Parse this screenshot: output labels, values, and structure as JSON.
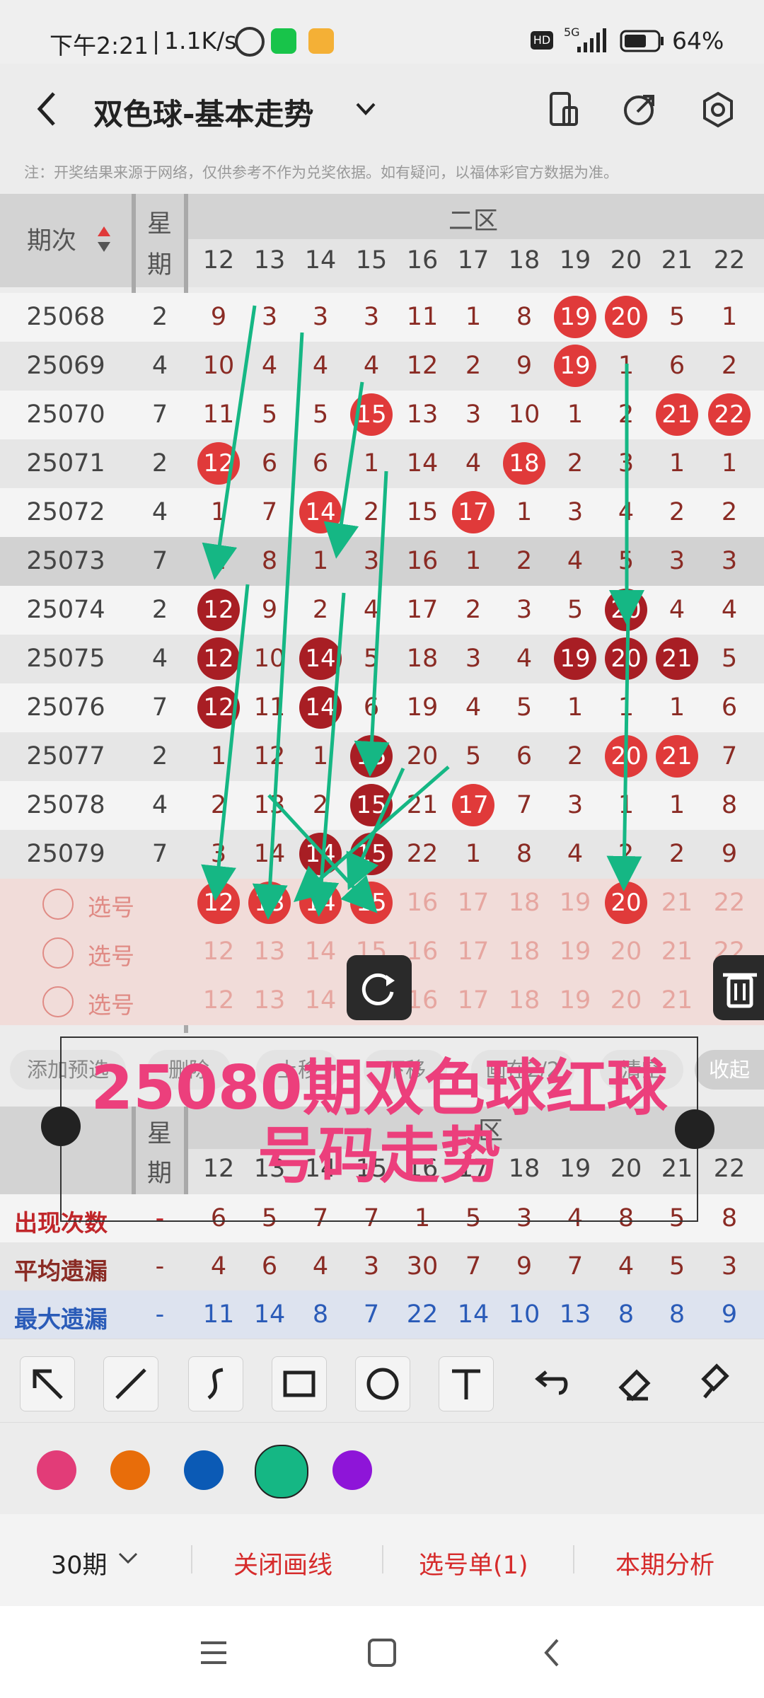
{
  "status_bar": {
    "time": "下午2:21",
    "speed": "1.1K/s",
    "network": "5G",
    "hd": "HD",
    "battery": "64%"
  },
  "header": {
    "title": "双色球-基本走势"
  },
  "notice": "注：开奖结果来源于网络，仅供参考不作为兑奖依据。如有疑问，以福体彩官方数据为准。",
  "table": {
    "col_issue": "期次",
    "col_week_1": "星",
    "col_week_2": "期",
    "zone_label": "二区",
    "numbers": [
      "12",
      "13",
      "14",
      "15",
      "16",
      "17",
      "18",
      "19",
      "20",
      "21",
      "22"
    ],
    "rows": [
      {
        "issue": "25068",
        "week": "2",
        "cells": [
          "9",
          "3",
          "3",
          "3",
          "11",
          "1",
          "8",
          "19",
          "20",
          "5",
          "1"
        ],
        "balls": [
          7,
          8
        ]
      },
      {
        "issue": "25069",
        "week": "4",
        "cells": [
          "10",
          "4",
          "4",
          "4",
          "12",
          "2",
          "9",
          "19",
          "1",
          "6",
          "2"
        ],
        "balls": [
          7
        ]
      },
      {
        "issue": "25070",
        "week": "7",
        "cells": [
          "11",
          "5",
          "5",
          "15",
          "13",
          "3",
          "10",
          "1",
          "2",
          "21",
          "22"
        ],
        "balls": [
          3,
          9,
          10
        ]
      },
      {
        "issue": "25071",
        "week": "2",
        "cells": [
          "12",
          "6",
          "6",
          "1",
          "14",
          "4",
          "18",
          "2",
          "3",
          "1",
          "1"
        ],
        "balls": [
          0,
          6
        ]
      },
      {
        "issue": "25072",
        "week": "4",
        "cells": [
          "1",
          "7",
          "14",
          "2",
          "15",
          "17",
          "1",
          "3",
          "4",
          "2",
          "2"
        ],
        "balls": [
          2,
          5
        ]
      },
      {
        "issue": "25073",
        "week": "7",
        "cells": [
          "2",
          "8",
          "1",
          "3",
          "16",
          "1",
          "2",
          "4",
          "5",
          "3",
          "3"
        ],
        "balls": []
      },
      {
        "issue": "25074",
        "week": "2",
        "cells": [
          "12",
          "9",
          "2",
          "4",
          "17",
          "2",
          "3",
          "5",
          "20",
          "4",
          "4"
        ],
        "balls": [
          0,
          8
        ]
      },
      {
        "issue": "25075",
        "week": "4",
        "cells": [
          "12",
          "10",
          "14",
          "5",
          "18",
          "3",
          "4",
          "19",
          "20",
          "21",
          "5"
        ],
        "balls": [
          0,
          2,
          7,
          8,
          9
        ]
      },
      {
        "issue": "25076",
        "week": "7",
        "cells": [
          "12",
          "11",
          "14",
          "6",
          "19",
          "4",
          "5",
          "1",
          "1",
          "1",
          "6"
        ],
        "balls": [
          0,
          2
        ]
      },
      {
        "issue": "25077",
        "week": "2",
        "cells": [
          "1",
          "12",
          "1",
          "15",
          "20",
          "5",
          "6",
          "2",
          "20",
          "21",
          "7"
        ],
        "balls": [
          3,
          8,
          9
        ]
      },
      {
        "issue": "25078",
        "week": "4",
        "cells": [
          "2",
          "13",
          "2",
          "15",
          "21",
          "17",
          "7",
          "3",
          "1",
          "1",
          "8"
        ],
        "balls": [
          3,
          5
        ]
      },
      {
        "issue": "25079",
        "week": "7",
        "cells": [
          "3",
          "14",
          "14",
          "15",
          "22",
          "1",
          "8",
          "4",
          "2",
          "2",
          "9"
        ],
        "balls": [
          2,
          3
        ]
      }
    ],
    "select_label": "选号",
    "select_rows": [
      {
        "balls": [
          0,
          1,
          2,
          3,
          8
        ]
      },
      {
        "balls": []
      },
      {
        "balls": []
      }
    ]
  },
  "actions": {
    "add": "添加预选",
    "delete": "删除",
    "up": "上移",
    "down": "下移",
    "position": "画在2/2",
    "clear": "清空",
    "collapse": "收起"
  },
  "annotation": {
    "line1": "25080期双色球红球",
    "line2": "号码走势"
  },
  "stats": {
    "col_week_1": "星",
    "col_week_2": "期",
    "zone_label": "区",
    "rows": [
      {
        "label": "出现次数",
        "dash": "-",
        "values": [
          "6",
          "5",
          "7",
          "7",
          "1",
          "5",
          "3",
          "4",
          "8",
          "5",
          "8"
        ],
        "color": "#8a2b24",
        "label_color": "#c0262a"
      },
      {
        "label": "平均遗漏",
        "dash": "-",
        "values": [
          "4",
          "6",
          "4",
          "3",
          "30",
          "7",
          "9",
          "7",
          "4",
          "5",
          "3"
        ],
        "color": "#8a2b24",
        "label_color": "#8a2b24"
      },
      {
        "label": "最大遗漏",
        "dash": "-",
        "values": [
          "11",
          "14",
          "8",
          "7",
          "22",
          "14",
          "10",
          "13",
          "8",
          "8",
          "9"
        ],
        "color": "#2a5bb8",
        "label_color": "#2a5bb8"
      }
    ]
  },
  "palette": [
    "#e23c78",
    "#e86d0a",
    "#0b5ab5",
    "#15b784",
    "#8e15d8"
  ],
  "bottom": {
    "period": "30期",
    "close_draw": "关闭画线",
    "selection": "选号单(1)",
    "analysis": "本期分析"
  }
}
